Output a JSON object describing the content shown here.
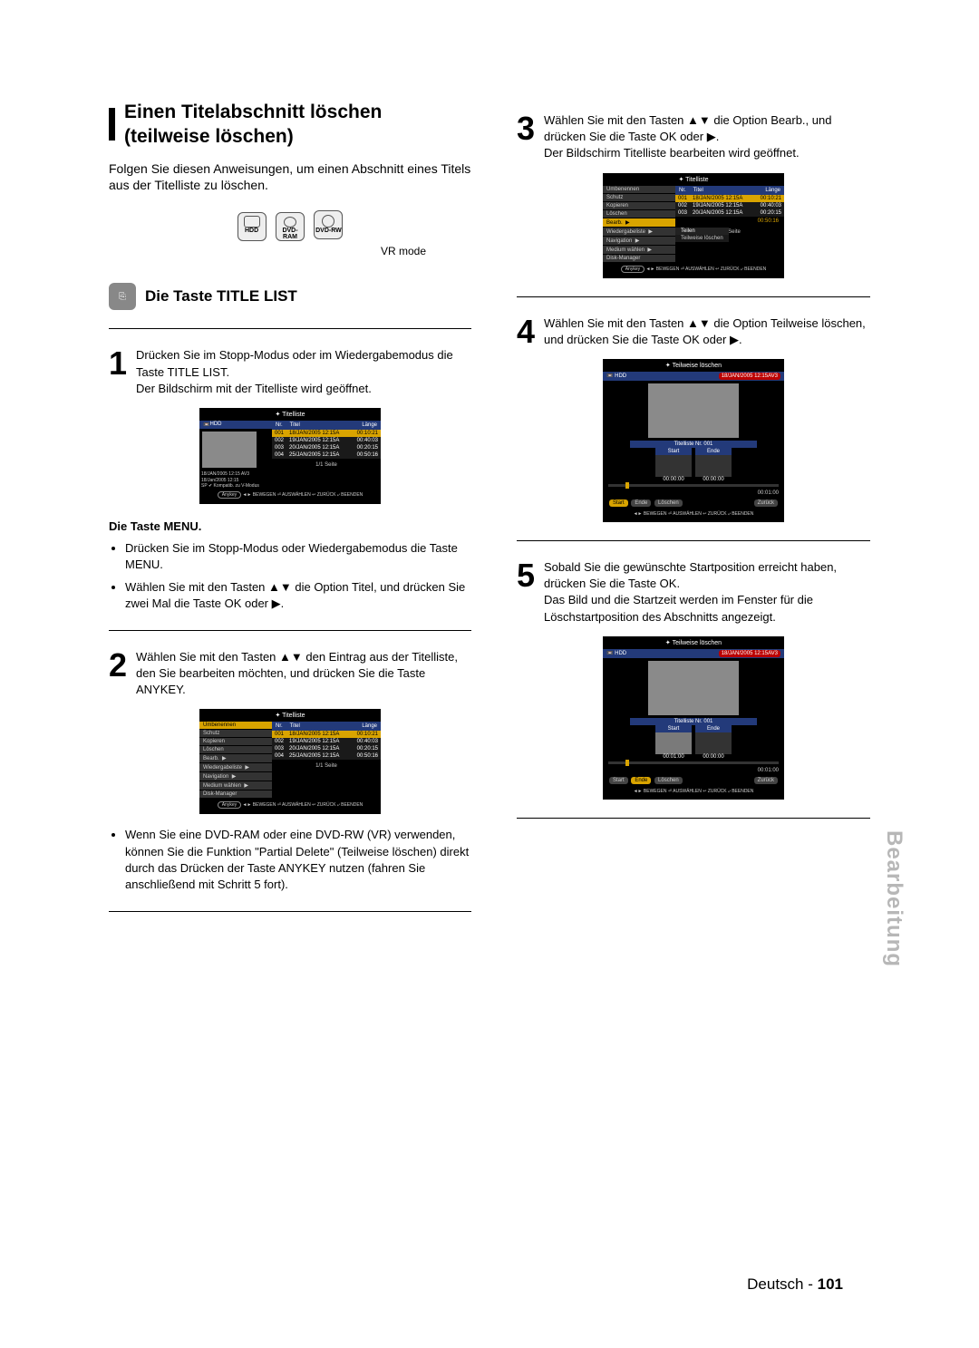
{
  "header": {
    "section_title": "Einen Titelabschnitt löschen (teilweise löschen)",
    "intro": "Folgen Sie diesen Anweisungen, um einen Abschnitt eines Titels aus der Titelliste zu löschen.",
    "discs": {
      "hdd": "HDD",
      "ram": "DVD-RAM",
      "rw": "DVD-RW"
    },
    "vr_mode": "VR mode",
    "sub_heading": "Die Taste TITLE LIST"
  },
  "stepsLeft": {
    "s1": {
      "num": "1",
      "text": "Drücken Sie im Stopp-Modus oder im Wiedergabemodus die Taste TITLE LIST.",
      "text2": "Der Bildschirm mit der Titelliste wird geöffnet."
    },
    "menu_heading": "Die Taste MENU.",
    "bullet1": "Drücken Sie im Stopp-Modus oder Wiedergabemodus die Taste MENU.",
    "bullet2": "Wählen Sie mit den Tasten ▲▼ die Option Titel, und drücken Sie zwei Mal die Taste OK oder ▶.",
    "s2": {
      "num": "2",
      "text": "Wählen Sie mit den Tasten ▲▼ den Eintrag aus der Titelliste, den Sie bearbeiten möchten, und drücken Sie die Taste ANYKEY."
    },
    "bullet_bottom": "Wenn Sie eine DVD-RAM oder eine DVD-RW (VR) verwenden, können Sie die Funktion \"Partial Delete\" (Teilweise löschen) direkt durch das Drücken der Taste ANYKEY nutzen (fahren Sie anschließend mit Schritt 5 fort)."
  },
  "stepsRight": {
    "s3": {
      "num": "3",
      "text": "Wählen Sie mit den Tasten ▲▼ die Option Bearb., und drücken Sie die Taste OK oder ▶.",
      "text2": "Der Bildschirm Titelliste bearbeiten wird geöffnet."
    },
    "s4": {
      "num": "4",
      "text": "Wählen Sie mit den Tasten ▲▼ die Option Teilweise löschen, und drücken Sie die Taste OK oder ▶."
    },
    "s5": {
      "num": "5",
      "text": "Sobald Sie die gewünschte Startposition erreicht haben, drücken Sie die Taste OK.",
      "text2": "Das Bild und die Startzeit werden im Fenster für die Löschstartposition des Abschnitts angezeigt."
    }
  },
  "osd": {
    "titelliste": "Titelliste",
    "teilweise": "Teilweise löschen",
    "hdd": "HDD",
    "cols": {
      "nr": "Nr.",
      "titel": "Titel",
      "laenge": "Länge"
    },
    "rows": [
      {
        "nr": "001",
        "date": "18/JAN/2005 12:15A",
        "len": "00:10:21"
      },
      {
        "nr": "002",
        "date": "19/JAN/2005 12:15A",
        "len": "00:40:03"
      },
      {
        "nr": "003",
        "date": "20/JAN/2005 12:15A",
        "len": "00:20:15"
      },
      {
        "nr": "004",
        "date": "25/JAN/2005 12:15A",
        "len": "00:50:16"
      }
    ],
    "info_lines": [
      "18/JAN/2005 12:15 AV3",
      "18/Jan/2005 12:15",
      "SP ✔ Kompatib. zu V-Modus"
    ],
    "page": "1/1 Seite",
    "foot": "◄► BEWEGEN  ⏎ AUSWÄHLEN  ↩ ZURÜCK  ⤶ BEENDEN",
    "anykey": "Anykey",
    "menu": {
      "umbenennen": "Umbenennen",
      "schutz": "Schutz",
      "kopieren": "Kopieren",
      "loeschen": "Löschen",
      "bearb": "Bearb.",
      "teilen": "Teilen",
      "teilweise": "Teilweise löschen",
      "wiedergabeliste": "Wiedergabeliste",
      "navigation": "Navigation",
      "medium": "Medium wählen",
      "disk": "Disk-Manager"
    },
    "rec_title": "18/JAN/2005 12:15AV3",
    "titelliste_nr": "Titelliste Nr. 001",
    "start": "Start",
    "ende": "Ende",
    "t0": "00:00:00",
    "t1": "00:01:00",
    "loeschen_btn": "Löschen",
    "zurueck": "Zurück"
  },
  "side_tab": "Bearbeitung",
  "footer": {
    "lang": "Deutsch - ",
    "page": "101"
  }
}
